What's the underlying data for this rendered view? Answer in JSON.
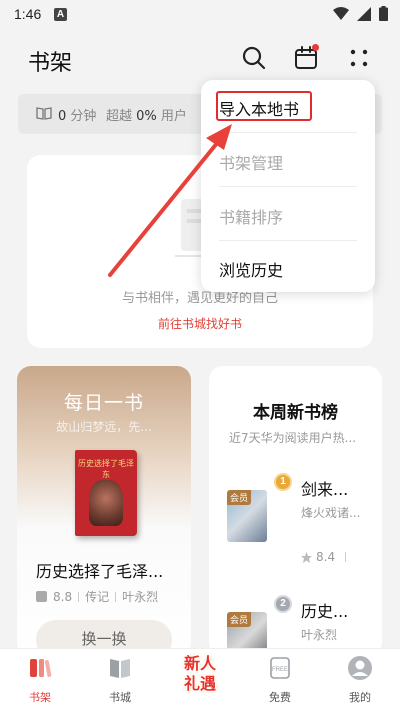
{
  "status_bar": {
    "time": "1:46",
    "notification_letter": "A"
  },
  "header": {
    "title": "书架"
  },
  "stats": {
    "minutes_value": "0",
    "minutes_unit": "分钟",
    "beat_prefix": "超越",
    "beat_value": "0%",
    "beat_suffix": "用户"
  },
  "empty_shelf": {
    "message": "与书相伴，遇见更好的自己",
    "link": "前往书城找好书"
  },
  "daily_book": {
    "title": "每日一书",
    "subtitle": "故山归梦远，先...",
    "cover_title": "历史选择了毛泽东",
    "book_name": "历史选择了毛泽...",
    "score": "8.8",
    "category": "传记",
    "author": "叶永烈",
    "refresh_button": "换一换"
  },
  "weekly_new": {
    "title": "本周新书榜",
    "subtitle": "近7天华为阅读用户热...",
    "books": [
      {
        "rank": "1",
        "tag": "会员",
        "name": "剑来...",
        "author": "烽火戏诸...",
        "score": "8.4"
      },
      {
        "rank": "2",
        "tag": "会员",
        "name": "历史...",
        "author": "叶永烈"
      }
    ]
  },
  "menu": {
    "items": [
      {
        "label": "导入本地书",
        "enabled": true
      },
      {
        "label": "书架管理",
        "enabled": false
      },
      {
        "label": "书籍排序",
        "enabled": false
      },
      {
        "label": "浏览历史",
        "enabled": true
      }
    ]
  },
  "bottom_nav": {
    "items": [
      {
        "label": "书架",
        "icon": "bookshelf-icon",
        "active": true
      },
      {
        "label": "书城",
        "icon": "book-store-icon",
        "active": false
      },
      {
        "label": "免费",
        "icon": "free-icon",
        "active": false
      },
      {
        "label": "我的",
        "icon": "profile-icon",
        "active": false
      }
    ],
    "promo": {
      "line1": "新人",
      "line2": "礼遇"
    }
  },
  "colors": {
    "accent": "#e0433a",
    "highlight": "#e22b2b"
  }
}
